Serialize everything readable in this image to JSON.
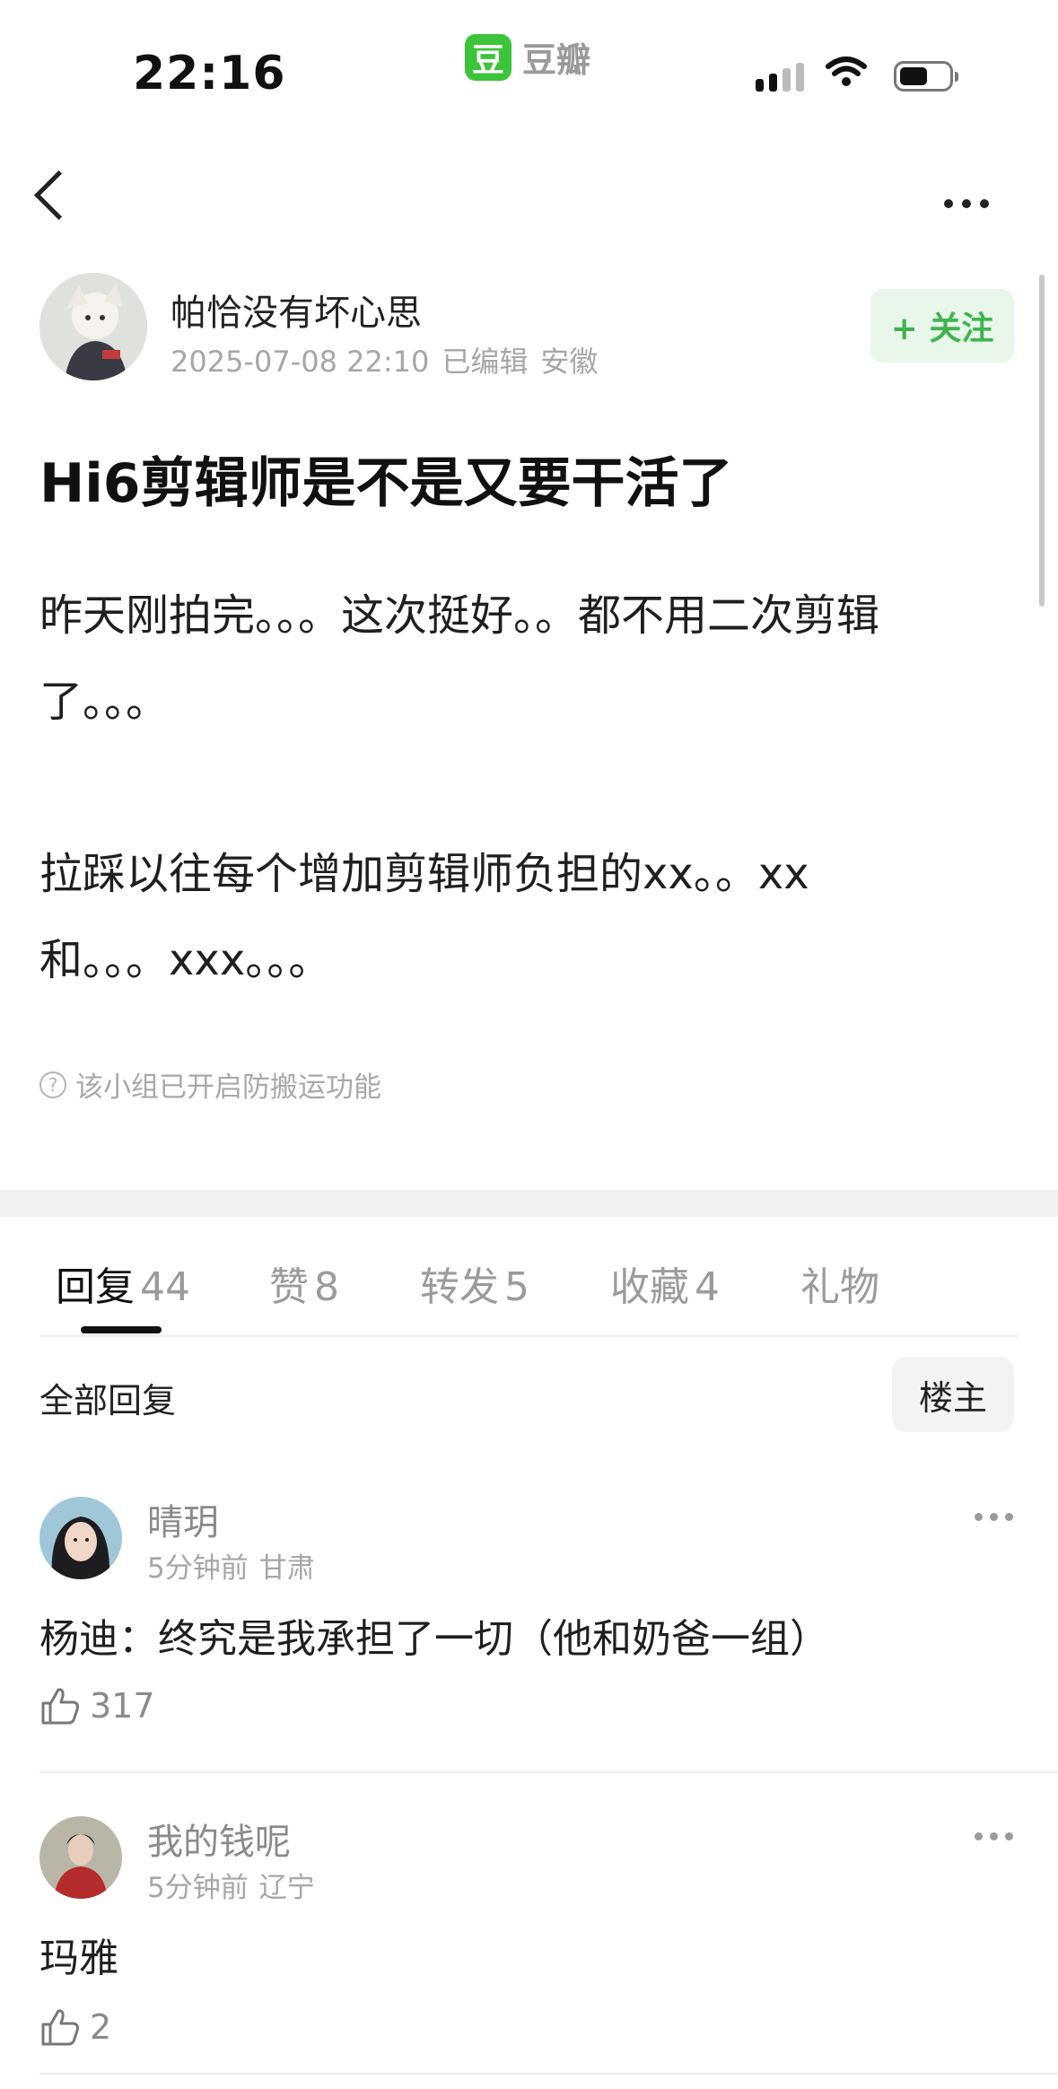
{
  "status_bar": {
    "time": "22:16",
    "app_logo_mark": "豆",
    "app_logo_text": "豆瓣",
    "icons": [
      "signal-icon",
      "wifi-icon",
      "battery-icon"
    ]
  },
  "nav": {
    "icons": [
      "back-icon",
      "more-icon"
    ]
  },
  "post": {
    "author": {
      "name": "帕恰没有坏心思",
      "datetime": "2025-07-08 22:10",
      "edited": "已编辑",
      "location": "安徽"
    },
    "follow_label": "+ 关注",
    "title": "Hi6剪辑师是不是又要干活了",
    "body_lines": [
      "昨天刚拍完。。。这次挺好。。都不用二次剪辑",
      "了。。。",
      "拉踩以往每个增加剪辑师负担的xx。。xx",
      "和。。。xxx。。。"
    ],
    "notice": "该小组已开启防搬运功能"
  },
  "tabs": [
    {
      "label": "回复",
      "count": "44",
      "active": true
    },
    {
      "label": "赞",
      "count": "8"
    },
    {
      "label": "转发",
      "count": "5"
    },
    {
      "label": "收藏",
      "count": "4"
    },
    {
      "label": "礼物",
      "count": ""
    }
  ],
  "replies_header": {
    "title": "全部回复",
    "filter_label": "楼主"
  },
  "comments": [
    {
      "name": "晴玥",
      "time": "5分钟前",
      "location": "甘肃",
      "text": "杨迪：终究是我承担了一切（他和奶爸一组）",
      "likes": "317"
    },
    {
      "name": "我的钱呢",
      "time": "5分钟前",
      "location": "辽宁",
      "text": "玛雅",
      "likes": "2"
    }
  ],
  "colors": {
    "brand_green": "#3cc43a",
    "follow_green": "#3fb34f",
    "follow_bg": "#e9f7ea"
  }
}
